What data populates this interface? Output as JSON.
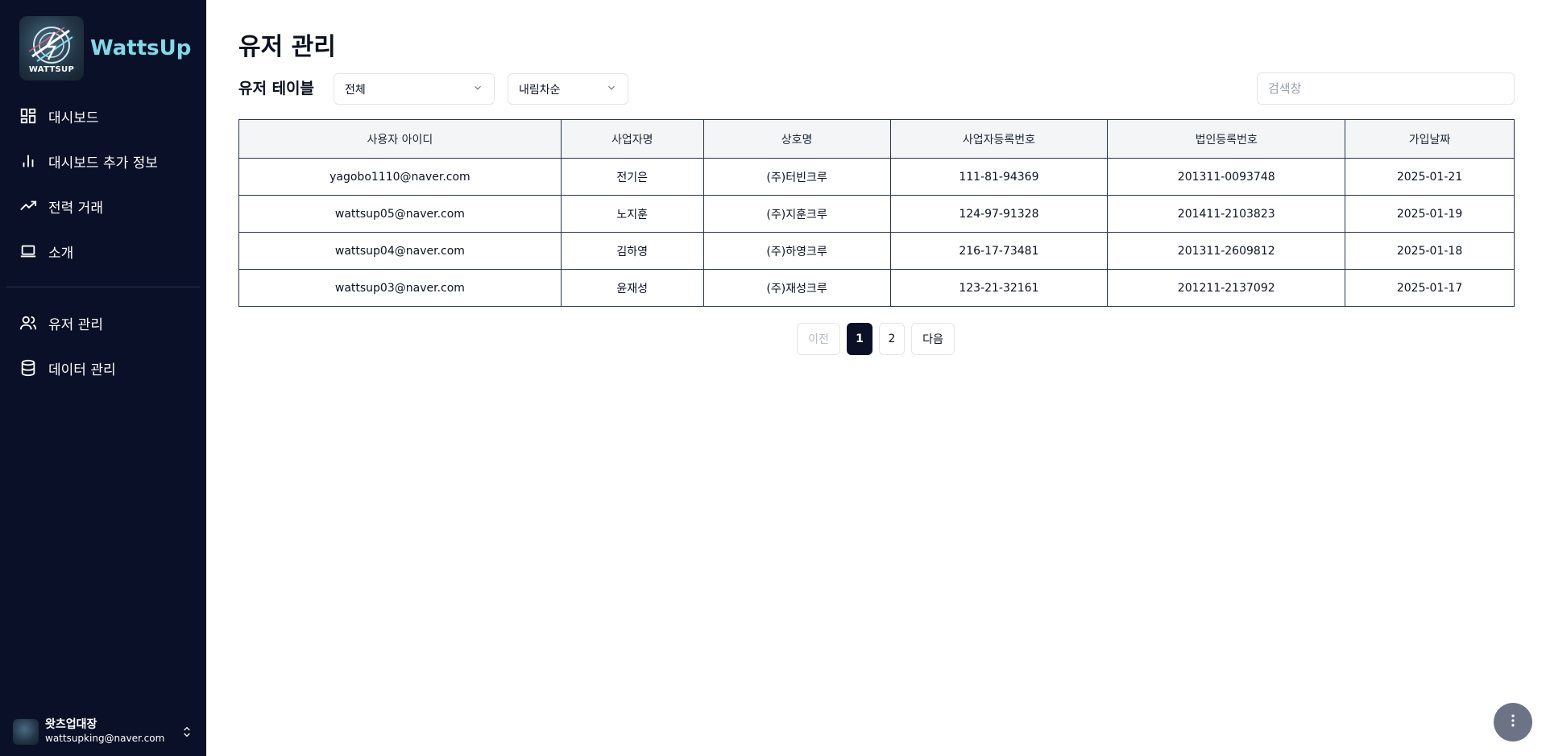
{
  "brand": {
    "name": "WattsUp",
    "logo_text": "WATTSUP"
  },
  "sidebar": {
    "items": [
      {
        "label": "대시보드",
        "icon": "dashboard-icon"
      },
      {
        "label": "대시보드 추가 정보",
        "icon": "bar-chart-icon"
      },
      {
        "label": "전력 거래",
        "icon": "trending-up-icon"
      },
      {
        "label": "소개",
        "icon": "laptop-icon"
      },
      {
        "label": "유저 관리",
        "icon": "users-icon"
      },
      {
        "label": "데이터 관리",
        "icon": "database-icon"
      }
    ],
    "user": {
      "name": "왓츠업대장",
      "email": "wattsupking@naver.com"
    }
  },
  "main": {
    "title": "유저 관리",
    "table_title": "유저 테이블",
    "filter": {
      "value": "전체"
    },
    "sort": {
      "value": "내림차순"
    },
    "search": {
      "placeholder": "검색창"
    },
    "table": {
      "headers": [
        "사용자 아이디",
        "사업자명",
        "상호명",
        "사업자등록번호",
        "법인등록번호",
        "가입날짜"
      ],
      "rows": [
        [
          "yagobo1110@naver.com",
          "전기은",
          "(주)터빈크루",
          "111-81-94369",
          "201311-0093748",
          "2025-01-21"
        ],
        [
          "wattsup05@naver.com",
          "노지훈",
          "(주)지훈크루",
          "124-97-91328",
          "201411-2103823",
          "2025-01-19"
        ],
        [
          "wattsup04@naver.com",
          "김하영",
          "(주)하영크루",
          "216-17-73481",
          "201311-2609812",
          "2025-01-18"
        ],
        [
          "wattsup03@naver.com",
          "윤재성",
          "(주)재성크루",
          "123-21-32161",
          "201211-2137092",
          "2025-01-17"
        ]
      ]
    },
    "pagination": {
      "prev": "이전",
      "pages": [
        "1",
        "2"
      ],
      "current": "1",
      "next": "다음"
    }
  },
  "colors": {
    "sidebar_bg": "#0a1027",
    "brand_accent": "#7fdbe8",
    "active_page": "#0a1027",
    "fab": "#6b7385"
  }
}
